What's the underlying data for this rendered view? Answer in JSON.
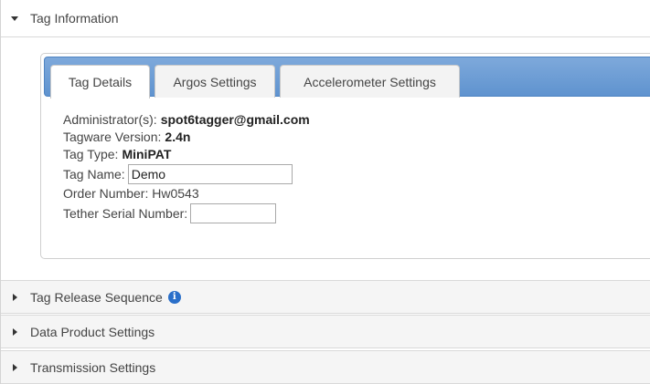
{
  "sections": {
    "tag_information": "Tag Information",
    "tag_release_sequence": "Tag Release Sequence",
    "data_product_settings": "Data Product Settings",
    "transmission_settings": "Transmission Settings"
  },
  "tabs": [
    {
      "label": "Tag Details",
      "active": true
    },
    {
      "label": "Argos Settings",
      "active": false
    },
    {
      "label": "Accelerometer Settings",
      "active": false
    }
  ],
  "details": {
    "administrator_label": "Administrator(s):",
    "administrator_value": "spot6tagger@gmail.com",
    "tagware_label": "Tagware Version:",
    "tagware_value": "2.4n",
    "tag_type_label": "Tag Type:",
    "tag_type_value": "MiniPAT",
    "tag_name_label": "Tag Name:",
    "tag_name_value": "Demo",
    "order_number_text": "Order Number: Hw0543",
    "tether_label": "Tether Serial Number:",
    "tether_value": ""
  },
  "icons": {
    "info": "i"
  },
  "colors": {
    "tabbar_blue": "#6b9ad3",
    "info_icon_blue": "#2a6fc9"
  }
}
